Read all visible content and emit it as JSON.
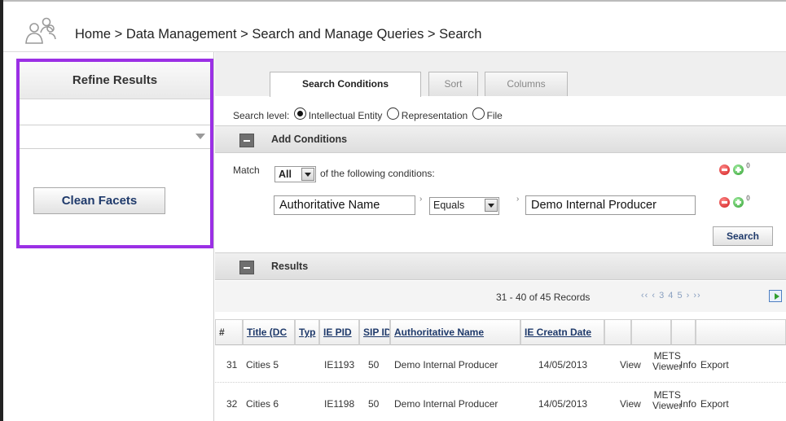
{
  "breadcrumb": "Home > Data Management > Search and Manage Queries > Search",
  "header": {
    "logo_icon": "users-group-icon"
  },
  "refine": {
    "title": "Refine Results",
    "dropdown_value": "",
    "clean_facets_label": "Clean Facets"
  },
  "tabs": [
    {
      "label": "Search Conditions",
      "active": true
    },
    {
      "label": "Sort",
      "active": false
    },
    {
      "label": "Columns",
      "active": false
    }
  ],
  "search_level": {
    "label": "Search level:",
    "options": [
      {
        "label": "Intellectual Entity",
        "checked": true
      },
      {
        "label": "Representation",
        "checked": false
      },
      {
        "label": "File",
        "checked": false
      }
    ]
  },
  "conditions": {
    "section_label": "Add Conditions",
    "match_label": "Match",
    "match_value": "All",
    "match_suffix": "of the following conditions:",
    "field": "Authoritative Name",
    "operator": "Equals",
    "value": "Demo Internal Producer",
    "search_button": "Search",
    "accent_color": "#9b30e5"
  },
  "results": {
    "section_label": "Results",
    "records_text": "31 - 40 of 45 Records",
    "pager_text": "‹‹ ‹ 3 4 5 › ››",
    "columns": [
      "#",
      "Title (DC",
      "Typ",
      "IE PID",
      "SIP ID",
      "Authoritative Name",
      "IE Creatn Date",
      "",
      "",
      "",
      ""
    ],
    "rows": [
      {
        "num": "31",
        "title": "Cities 5",
        "type": "",
        "ie_pid": "IE1193",
        "sip_id": "50",
        "auth_name": "Demo Internal Producer",
        "date": "14/05/2013",
        "view": "View",
        "mets": "METS",
        "viewer": "Viewer",
        "info": "Info",
        "export": "Export"
      },
      {
        "num": "32",
        "title": "Cities 6",
        "type": "",
        "ie_pid": "IE1198",
        "sip_id": "50",
        "auth_name": "Demo Internal Producer",
        "date": "14/05/2013",
        "view": "View",
        "mets": "METS",
        "viewer": "Viewer",
        "info": "Info",
        "export": "Export"
      }
    ]
  }
}
